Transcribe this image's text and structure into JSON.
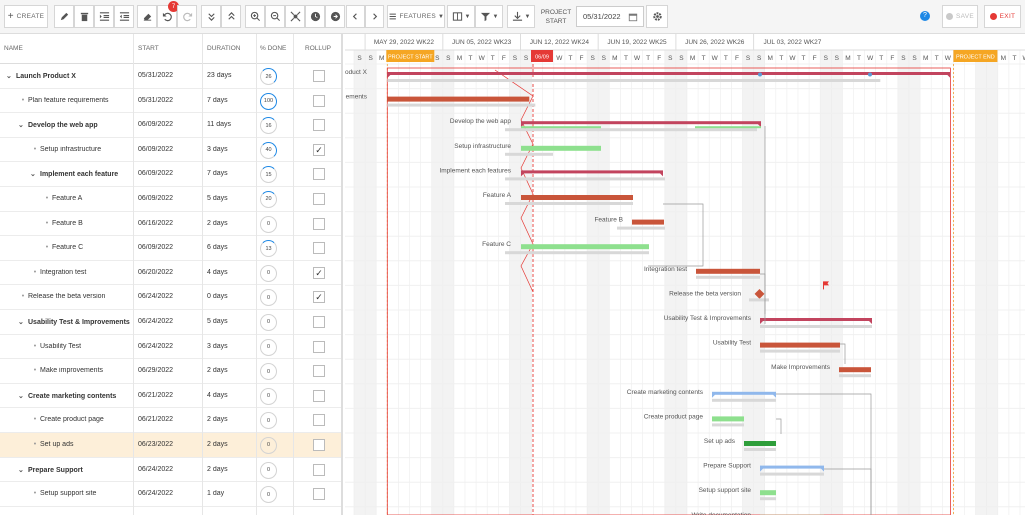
{
  "toolbar": {
    "create_label": "CREATE",
    "features_label": "FEATURES",
    "undo_badge": "7",
    "project_start_label": "PROJECT START",
    "project_start_value": "05/31/2022",
    "save_label": "SAVE",
    "exit_label": "EXIT"
  },
  "grid": {
    "headers": {
      "name": "NAME",
      "start": "START",
      "duration": "DURATION",
      "done": "% DONE",
      "rollup": "ROLLUP"
    },
    "rows": [
      {
        "name": "Launch Product X",
        "start": "05/31/2022",
        "duration": "23 days",
        "done": "26",
        "level": 0,
        "parent": true,
        "rollup": false,
        "pct": 0.26
      },
      {
        "name": "Plan feature requirements",
        "start": "05/31/2022",
        "duration": "7 days",
        "done": "100",
        "level": 1,
        "parent": false,
        "rollup": false,
        "pct": 1.0
      },
      {
        "name": "Develop the web app",
        "start": "06/09/2022",
        "duration": "11 days",
        "done": "16",
        "level": 1,
        "parent": true,
        "rollup": false,
        "pct": 0.16
      },
      {
        "name": "Setup infrastructure",
        "start": "06/09/2022",
        "duration": "3 days",
        "done": "40",
        "level": 2,
        "parent": false,
        "rollup": true,
        "pct": 0.4
      },
      {
        "name": "Implement each feature",
        "start": "06/09/2022",
        "duration": "7 days",
        "done": "15",
        "level": 2,
        "parent": true,
        "rollup": false,
        "pct": 0.15
      },
      {
        "name": "Feature A",
        "start": "06/09/2022",
        "duration": "5 days",
        "done": "20",
        "level": 3,
        "parent": false,
        "rollup": false,
        "pct": 0.2
      },
      {
        "name": "Feature B",
        "start": "06/16/2022",
        "duration": "2 days",
        "done": "0",
        "level": 3,
        "parent": false,
        "rollup": false,
        "pct": 0
      },
      {
        "name": "Feature C",
        "start": "06/09/2022",
        "duration": "6 days",
        "done": "13",
        "level": 3,
        "parent": false,
        "rollup": false,
        "pct": 0.13
      },
      {
        "name": "Integration test",
        "start": "06/20/2022",
        "duration": "4 days",
        "done": "0",
        "level": 2,
        "parent": false,
        "rollup": true,
        "pct": 0
      },
      {
        "name": "Release the beta version",
        "start": "06/24/2022",
        "duration": "0 days",
        "done": "0",
        "level": 1,
        "parent": false,
        "rollup": true,
        "pct": 0
      },
      {
        "name": "Usability Test & Improvements",
        "start": "06/24/2022",
        "duration": "5 days",
        "done": "0",
        "level": 1,
        "parent": true,
        "rollup": false,
        "pct": 0
      },
      {
        "name": "Usability Test",
        "start": "06/24/2022",
        "duration": "3 days",
        "done": "0",
        "level": 2,
        "parent": false,
        "rollup": false,
        "pct": 0
      },
      {
        "name": "Make improvements",
        "start": "06/29/2022",
        "duration": "2 days",
        "done": "0",
        "level": 2,
        "parent": false,
        "rollup": false,
        "pct": 0
      },
      {
        "name": "Create marketing contents",
        "start": "06/21/2022",
        "duration": "4 days",
        "done": "0",
        "level": 1,
        "parent": true,
        "rollup": false,
        "pct": 0
      },
      {
        "name": "Create product page",
        "start": "06/21/2022",
        "duration": "2 days",
        "done": "0",
        "level": 2,
        "parent": false,
        "rollup": false,
        "pct": 0
      },
      {
        "name": "Set up ads",
        "start": "06/23/2022",
        "duration": "2 days",
        "done": "0",
        "level": 2,
        "parent": false,
        "rollup": false,
        "pct": 0,
        "selected": true
      },
      {
        "name": "Prepare Support",
        "start": "06/24/2022",
        "duration": "2 days",
        "done": "0",
        "level": 1,
        "parent": true,
        "rollup": false,
        "pct": 0
      },
      {
        "name": "Setup support site",
        "start": "06/24/2022",
        "duration": "1 day",
        "done": "0",
        "level": 2,
        "parent": false,
        "rollup": false,
        "pct": 0
      }
    ]
  },
  "timeline": {
    "weeks": [
      "MAY 29, 2022 WK22",
      "JUN 05, 2022 WK23",
      "JUN 12, 2022 WK24",
      "JUN 19, 2022 WK25",
      "JUN 26, 2022 WK26",
      "JUL 03, 2022 WK27"
    ],
    "day_letters": [
      "S",
      "M",
      "T",
      "W",
      "T",
      "F",
      "S"
    ],
    "project_start_tag": "PROJECT START",
    "project_end_tag": "PROJECT END",
    "today_tag": "06/09",
    "bar_labels": [
      "oduct X",
      "ements",
      "Develop the web app",
      "Setup infrastructure",
      "Implement each features",
      "Feature A",
      "Feature B",
      "Feature C",
      "Integration test",
      "Release the beta version",
      "Usability Test & Improvements",
      "Usability Test",
      "Make Improvements",
      "Create marketing contents",
      "Create product page",
      "Set up ads",
      "Prepare Support",
      "Setup support site",
      "Write documentation"
    ]
  }
}
